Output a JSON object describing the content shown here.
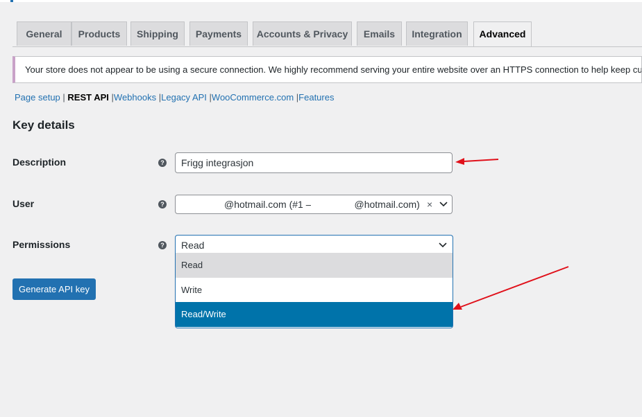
{
  "tabs": [
    {
      "label": "General",
      "active": false
    },
    {
      "label": "Products",
      "active": false
    },
    {
      "label": "Shipping",
      "active": false
    },
    {
      "label": "Payments",
      "active": false
    },
    {
      "label": "Accounts & Privacy",
      "active": false
    },
    {
      "label": "Emails",
      "active": false
    },
    {
      "label": "Integration",
      "active": false
    },
    {
      "label": "Advanced",
      "active": true
    }
  ],
  "notice": {
    "text": "Your store does not appear to be using a secure connection. We highly recommend serving your entire website over an HTTPS connection to help keep cust"
  },
  "subnav": {
    "items": [
      "Page setup",
      "REST API",
      "Webhooks",
      "Legacy API",
      "WooCommerce.com",
      "Features"
    ],
    "current": "REST API",
    "separator": "|"
  },
  "section": {
    "title": "Key details"
  },
  "form": {
    "description": {
      "label": "Description",
      "value": "Frigg integrasjon"
    },
    "user": {
      "label": "User",
      "value_part1": "@hotmail.com (#1 –",
      "value_part2": "@hotmail.com)",
      "clear_symbol": "×"
    },
    "permissions": {
      "label": "Permissions",
      "value": "Read",
      "options": [
        "Read",
        "Write",
        "Read/Write"
      ],
      "hovered_option": "Read",
      "highlighted_option": "Read/Write"
    },
    "help_symbol": "?"
  },
  "actions": {
    "generate_label": "Generate API key"
  },
  "colors": {
    "accent": "#2271b1",
    "dropdown_highlight": "#0073aa",
    "annotation_arrow": "#e0101a",
    "notice_border": "#c9a2c8"
  },
  "icons": {
    "help": "help-icon",
    "dropdown": "chevron-down-icon",
    "annotation": "red-arrow"
  }
}
